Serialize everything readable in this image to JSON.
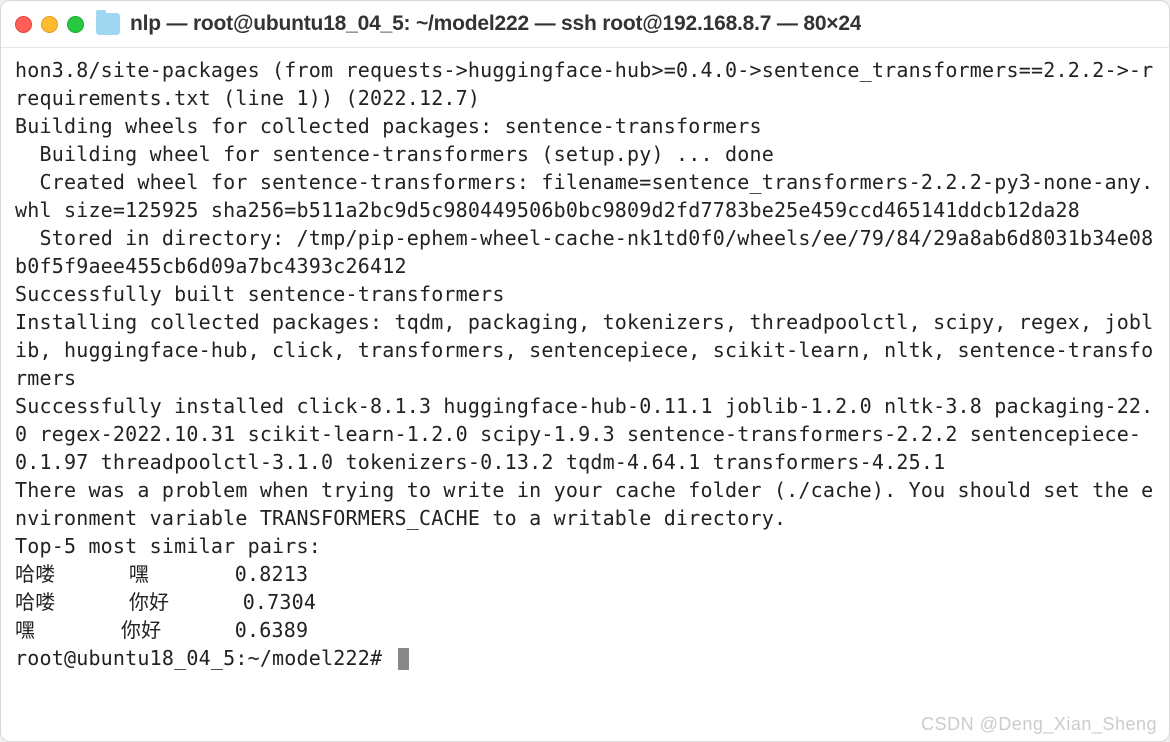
{
  "titlebar": {
    "title": "nlp — root@ubuntu18_04_5: ~/model222 — ssh root@192.168.8.7 — 80×24"
  },
  "terminal": {
    "lines": [
      "hon3.8/site-packages (from requests->huggingface-hub>=0.4.0->sentence_transformers==2.2.2->-r requirements.txt (line 1)) (2022.12.7)",
      "Building wheels for collected packages: sentence-transformers",
      "  Building wheel for sentence-transformers (setup.py) ... done",
      "  Created wheel for sentence-transformers: filename=sentence_transformers-2.2.2-py3-none-any.whl size=125925 sha256=b511a2bc9d5c980449506b0bc9809d2fd7783be25e459ccd465141ddcb12da28",
      "  Stored in directory: /tmp/pip-ephem-wheel-cache-nk1td0f0/wheels/ee/79/84/29a8ab6d8031b34e08b0f5f9aee455cb6d09a7bc4393c26412",
      "Successfully built sentence-transformers",
      "Installing collected packages: tqdm, packaging, tokenizers, threadpoolctl, scipy, regex, joblib, huggingface-hub, click, transformers, sentencepiece, scikit-learn, nltk, sentence-transformers",
      "Successfully installed click-8.1.3 huggingface-hub-0.11.1 joblib-1.2.0 nltk-3.8 packaging-22.0 regex-2022.10.31 scikit-learn-1.2.0 scipy-1.9.3 sentence-transformers-2.2.2 sentencepiece-0.1.97 threadpoolctl-3.1.0 tokenizers-0.13.2 tqdm-4.64.1 transformers-4.25.1",
      "There was a problem when trying to write in your cache folder (./cache). You should set the environment variable TRANSFORMERS_CACHE to a writable directory.",
      "Top-5 most similar pairs:",
      "哈喽      嘿       0.8213",
      "哈喽      你好      0.7304",
      "嘿       你好      0.6389"
    ],
    "prompt": "root@ubuntu18_04_5:~/model222# "
  },
  "watermark": "CSDN @Deng_Xian_Sheng"
}
